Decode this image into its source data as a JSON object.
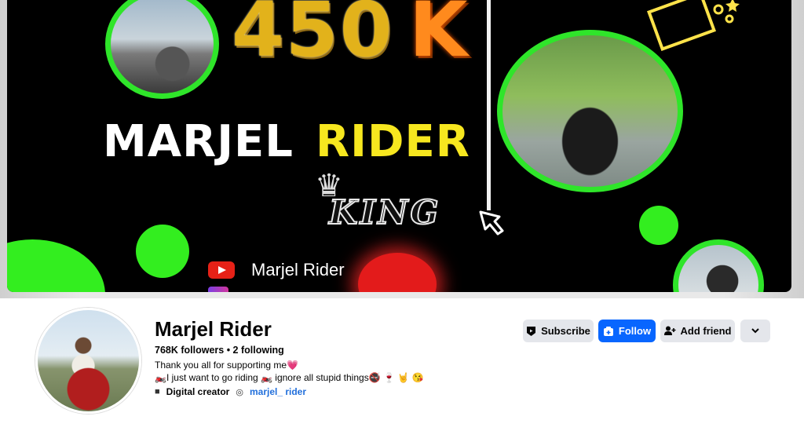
{
  "cover": {
    "big_number": "450",
    "big_suffix": "K",
    "title_white": "MARJEL",
    "title_yellow": "RIDER",
    "king_text": "KING",
    "channel_name": "Marjel Rider"
  },
  "profile": {
    "name": "Marjel Rider",
    "stats": "768K followers • 2 following",
    "bio_line1": "Thank you all for supporting me",
    "bio_line1_emoji": "💗",
    "bio_line2": "🏍️I just want to go riding 🏍️ ignore all stupid things🚭 🍷 🤘 😘",
    "category": "Digital creator",
    "instagram": "marjel_ rider"
  },
  "actions": {
    "subscribe_label": "Subscribe",
    "follow_label": "Follow",
    "add_friend_label": "Add friend"
  },
  "colors": {
    "accent_green": "#33ee1f",
    "follow_blue": "#0866ff",
    "button_gray": "#e4e6eb",
    "link_blue": "#216fdb"
  },
  "icons": [
    "youtube-icon",
    "instagram-icon",
    "subscribe-icon",
    "follow-icon",
    "add-friend-icon",
    "chevron-down-icon",
    "briefcase-icon"
  ]
}
